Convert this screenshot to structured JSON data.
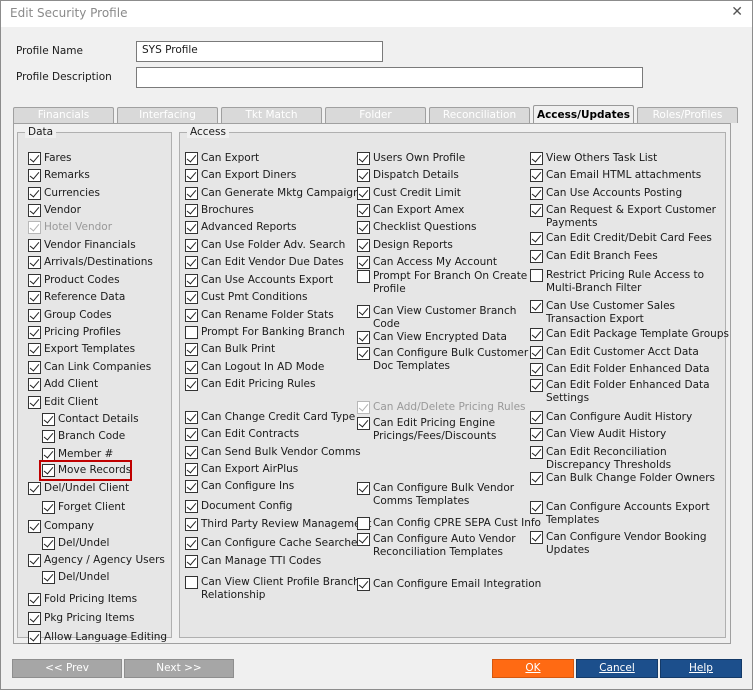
{
  "window": {
    "title": "Edit Security Profile"
  },
  "form": {
    "profile_name_label": "Profile Name",
    "profile_name_value": "SYS Profile",
    "profile_desc_label": "Profile Description",
    "profile_desc_value": ""
  },
  "tabs": [
    "Financials",
    "Interfacing",
    "Tkt Match",
    "Folder",
    "Reconciliation",
    "Access/Updates",
    "Roles/Profiles"
  ],
  "active_tab": "Access/Updates",
  "data_group": {
    "title": "Data",
    "items": [
      {
        "label": "Fares",
        "checked": true
      },
      {
        "label": "Remarks",
        "checked": true
      },
      {
        "label": "Currencies",
        "checked": true
      },
      {
        "label": "Vendor",
        "checked": true
      },
      {
        "label": "Hotel Vendor",
        "checked": true,
        "disabled": true
      },
      {
        "label": "Vendor Financials",
        "checked": true
      },
      {
        "label": "Arrivals/Destinations",
        "checked": true
      },
      {
        "label": "Product Codes",
        "checked": true
      },
      {
        "label": "Reference Data",
        "checked": true
      },
      {
        "label": "Group Codes",
        "checked": true
      },
      {
        "label": "Pricing Profiles",
        "checked": true
      },
      {
        "label": "Export Templates",
        "checked": true
      },
      {
        "label": "Can Link Companies",
        "checked": true
      },
      {
        "label": "Add Client",
        "checked": true
      },
      {
        "label": "Edit Client",
        "checked": true
      },
      {
        "label": "Contact Details",
        "checked": true,
        "indent": 1
      },
      {
        "label": "Branch Code",
        "checked": true,
        "indent": 1
      },
      {
        "label": "Member #",
        "checked": true,
        "indent": 1
      },
      {
        "label": "Move Records",
        "checked": true,
        "indent": 1,
        "highlight": true
      },
      {
        "label": "Del/Undel Client",
        "checked": true
      },
      {
        "label": "Forget Client",
        "checked": true,
        "indent": 1
      },
      {
        "label": "Company",
        "checked": true
      },
      {
        "label": "Del/Undel",
        "checked": true,
        "indent": 1
      },
      {
        "label": "Agency / Agency Users",
        "checked": true
      },
      {
        "label": "Del/Undel",
        "checked": true,
        "indent": 1
      },
      {
        "label": "Fold Pricing Items",
        "checked": true
      },
      {
        "label": "Pkg Pricing Items",
        "checked": true
      },
      {
        "label": "Allow Language Editing",
        "checked": true
      }
    ]
  },
  "access_group": {
    "title": "Access",
    "col1": [
      {
        "label": "Can Export",
        "checked": true
      },
      {
        "label": "Can Export Diners",
        "checked": true
      },
      {
        "label": "Can Generate Mktg Campaign",
        "checked": true
      },
      {
        "label": "Brochures",
        "checked": true
      },
      {
        "label": "Advanced Reports",
        "checked": true
      },
      {
        "label": "Can Use Folder Adv. Search",
        "checked": true
      },
      {
        "label": "Can Edit Vendor Due Dates",
        "checked": true
      },
      {
        "label": "Can Use Accounts Export",
        "checked": true
      },
      {
        "label": "Cust Pmt Conditions",
        "checked": true
      },
      {
        "label": "Can Rename Folder Stats",
        "checked": true
      },
      {
        "label": "Prompt For Banking Branch",
        "checked": false
      },
      {
        "label": "Can Bulk Print",
        "checked": true
      },
      {
        "label": "Can Logout In AD Mode",
        "checked": true
      },
      {
        "label": "Can Edit Pricing Rules",
        "checked": true
      },
      {
        "label": "Can Change Credit Card Type",
        "checked": true
      },
      {
        "label": "Can Edit Contracts",
        "checked": true
      },
      {
        "label": "Can Send Bulk Vendor Comms",
        "checked": true
      },
      {
        "label": "Can Export AirPlus",
        "checked": true
      },
      {
        "label": "Can Configure Ins",
        "checked": true
      },
      {
        "label": "Document Config",
        "checked": true
      },
      {
        "label": "Third Party Review Management",
        "checked": true
      },
      {
        "label": "Can Configure Cache Searches",
        "checked": true
      },
      {
        "label": "Can Manage TTI Codes",
        "checked": true
      },
      {
        "label": "Can View Client Profile Branch\nRelationship",
        "checked": false
      }
    ],
    "col2": [
      {
        "label": "Users Own Profile",
        "checked": true
      },
      {
        "label": "Dispatch Details",
        "checked": true
      },
      {
        "label": "Cust Credit Limit",
        "checked": true
      },
      {
        "label": "Can Export Amex",
        "checked": true
      },
      {
        "label": "Checklist Questions",
        "checked": true
      },
      {
        "label": "Design Reports",
        "checked": true
      },
      {
        "label": "Can Access My Account",
        "checked": true
      },
      {
        "label": "Prompt For Branch On Create\nProfile",
        "checked": false
      },
      {
        "label": "Can View Customer Branch\nCode",
        "checked": true
      },
      {
        "label": "Can View Encrypted Data",
        "checked": true
      },
      {
        "label": "Can Configure Bulk Customer\nDoc Templates",
        "checked": true
      },
      {
        "label": "Can Add/Delete Pricing Rules",
        "checked": true,
        "disabled": true
      },
      {
        "label": "Can Edit Pricing Engine\nPricings/Fees/Discounts",
        "checked": true
      },
      {
        "label": "Can Configure Bulk Vendor\nComms Templates",
        "checked": true
      },
      {
        "label": "Can Config CPRE SEPA Cust Info",
        "checked": false
      },
      {
        "label": "Can Configure Auto Vendor\nReconciliation Templates",
        "checked": true
      },
      {
        "label": "Can Configure Email Integration",
        "checked": true
      }
    ],
    "col3": [
      {
        "label": "View Others Task List",
        "checked": true
      },
      {
        "label": "Can Email HTML attachments",
        "checked": true
      },
      {
        "label": "Can Use Accounts Posting",
        "checked": true
      },
      {
        "label": "Can Request & Export Customer\nPayments",
        "checked": true
      },
      {
        "label": "Can Edit Credit/Debit Card Fees",
        "checked": true
      },
      {
        "label": "Can Edit Branch Fees",
        "checked": true
      },
      {
        "label": "Restrict Pricing Rule Access to\nMulti-Branch Filter",
        "checked": false
      },
      {
        "label": "Can Use Customer Sales\nTransaction Export",
        "checked": true
      },
      {
        "label": "Can Edit Package Template Groups",
        "checked": true
      },
      {
        "label": "Can Edit Customer Acct Data",
        "checked": true
      },
      {
        "label": "Can Edit Folder Enhanced Data",
        "checked": true
      },
      {
        "label": "Can Edit Folder Enhanced Data\nSettings",
        "checked": true
      },
      {
        "label": "Can Configure Audit History",
        "checked": true
      },
      {
        "label": "Can View Audit History",
        "checked": true
      },
      {
        "label": "Can Edit Reconciliation\nDiscrepancy Thresholds",
        "checked": true
      },
      {
        "label": "Can Bulk Change Folder Owners",
        "checked": true
      },
      {
        "label": "Can Configure Accounts Export\nTemplates",
        "checked": true
      },
      {
        "label": "Can Configure Vendor Booking\nUpdates",
        "checked": true
      }
    ]
  },
  "buttons": {
    "prev": "<< Prev",
    "next": "Next >>",
    "ok": "OK",
    "cancel": "Cancel",
    "help": "Help"
  },
  "icons": {
    "close": "close-icon"
  },
  "colors": {
    "ok": "#ff6a13",
    "primary": "#1c4f8c",
    "highlight": "#c00000"
  }
}
